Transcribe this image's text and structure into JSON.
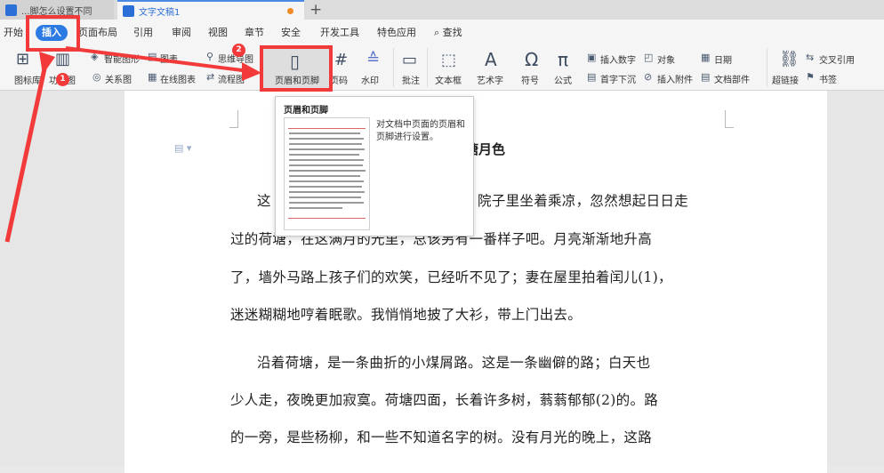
{
  "tabs": [
    {
      "label": "...脚怎么设置不同"
    },
    {
      "label": "文字文稿1"
    }
  ],
  "menu": {
    "items": [
      "开始",
      "插入",
      "页面布局",
      "引用",
      "审阅",
      "视图",
      "章节",
      "安全",
      "开发工具",
      "特色应用",
      "查找"
    ],
    "active": "插入"
  },
  "ribbon": {
    "smart_shape": "智能图形",
    "chart": "图表",
    "mindmap": "思维导图",
    "icon_lib": "图标库",
    "function_figure": "功能图",
    "relation": "关系图",
    "online_chart": "在线图表",
    "flowchart": "流程图",
    "header_footer": "页眉和页脚",
    "page_number": "页码",
    "watermark": "水印",
    "comment": "批注",
    "textbox": "文本框",
    "wordart": "艺术字",
    "symbol": "符号",
    "formula": "公式",
    "insert_number": "插入数字",
    "object": "对象",
    "date": "日期",
    "drop_cap": "首字下沉",
    "attachment": "插入附件",
    "doc_parts": "文档部件",
    "cross_ref": "交叉引用",
    "hyperlink": "超链接",
    "bookmark": "书签"
  },
  "tooltip": {
    "title": "页眉和页脚",
    "description": "对文档中页面的页眉和页脚进行设置。"
  },
  "document": {
    "title": "塘月色",
    "lines": [
      "这",
      "院子里坐着乘凉，忽然想起日日走",
      "过的荷塘，在这满月的光里，总该另有一番样子吧。月亮渐渐地升高",
      "了，墙外马路上孩子们的欢笑，已经听不见了；妻在屋里拍着闰儿(1)，",
      "迷迷糊糊地哼着眠歌。我悄悄地披了大衫，带上门出去。",
      "沿着荷塘，是一条曲折的小煤屑路。这是一条幽僻的路；白天也",
      "少人走，夜晚更加寂寞。荷塘四面，长着许多树，蓊蓊郁郁(2)的。路",
      "的一旁，是些杨柳，和一些不知道名字的树。没有月光的晚上，这路"
    ]
  },
  "annotations": {
    "badge1": "1",
    "badge2": "2"
  },
  "colors": {
    "accent": "#2c7be5",
    "highlight": "#f23a3a"
  }
}
